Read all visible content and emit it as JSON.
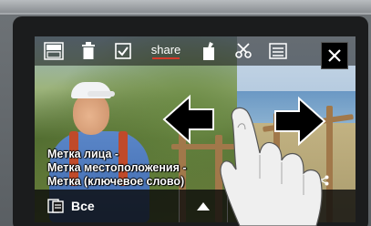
{
  "toolbar": {
    "items": [
      {
        "name": "face-tag-icon"
      },
      {
        "name": "trash-icon"
      },
      {
        "name": "checkbox-icon"
      },
      {
        "name": "share-label",
        "label": "share"
      },
      {
        "name": "edit-tag-icon"
      },
      {
        "name": "scissors-icon"
      },
      {
        "name": "list-icon"
      }
    ],
    "share_label": "share",
    "close_icon": "close-icon"
  },
  "caption": {
    "lines": [
      "Метка лица -",
      "Метка местоположения -",
      "Метка (ключевое слово)"
    ]
  },
  "status_icons": [
    "lock-icon",
    "mail-icon",
    "share-icon"
  ],
  "bottombar": {
    "filter_icon": "filter-icon",
    "filter_label": "Все",
    "up_icon": "triangle-up-icon"
  },
  "gesture": {
    "left_arrow": "arrow-left-icon",
    "right_arrow": "arrow-right-icon",
    "hand": "hand-swipe"
  }
}
